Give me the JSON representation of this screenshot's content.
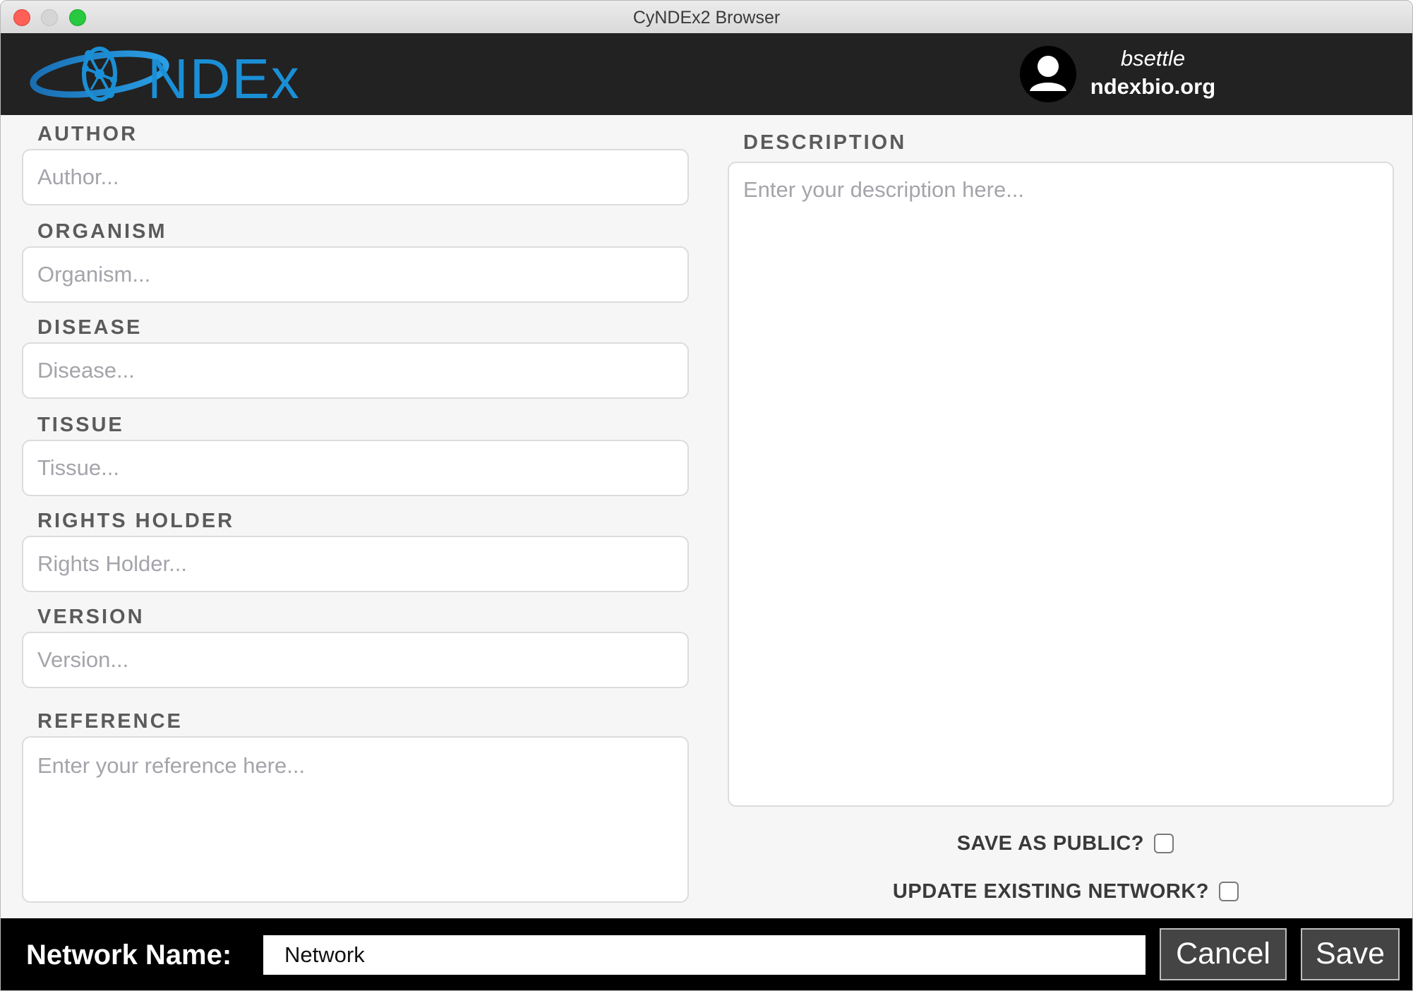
{
  "window": {
    "title": "CyNDEx2 Browser"
  },
  "header": {
    "logo_text": "NDEx",
    "user": {
      "username": "bsettle",
      "server": "ndexbio.org"
    }
  },
  "form": {
    "author": {
      "label": "AUTHOR",
      "placeholder": "Author...",
      "value": ""
    },
    "organism": {
      "label": "ORGANISM",
      "placeholder": "Organism...",
      "value": ""
    },
    "disease": {
      "label": "DISEASE",
      "placeholder": "Disease...",
      "value": ""
    },
    "tissue": {
      "label": "TISSUE",
      "placeholder": "Tissue...",
      "value": ""
    },
    "rights_holder": {
      "label": "RIGHTS HOLDER",
      "placeholder": "Rights Holder...",
      "value": ""
    },
    "version": {
      "label": "VERSION",
      "placeholder": "Version...",
      "value": ""
    },
    "reference": {
      "label": "REFERENCE",
      "placeholder": "Enter your reference here...",
      "value": ""
    },
    "description": {
      "label": "DESCRIPTION",
      "placeholder": "Enter your description here...",
      "value": ""
    },
    "save_public": {
      "label": "SAVE AS PUBLIC?",
      "checked": false
    },
    "update_existing": {
      "label": "UPDATE EXISTING NETWORK?",
      "checked": false
    }
  },
  "footer": {
    "network_name_label": "Network Name:",
    "network_name_value": "Network",
    "cancel_label": "Cancel",
    "save_label": "Save"
  },
  "colors": {
    "header_bg": "#222222",
    "logo_blue": "#1a8fd6",
    "footer_bg": "#000000",
    "button_bg": "#444444"
  }
}
